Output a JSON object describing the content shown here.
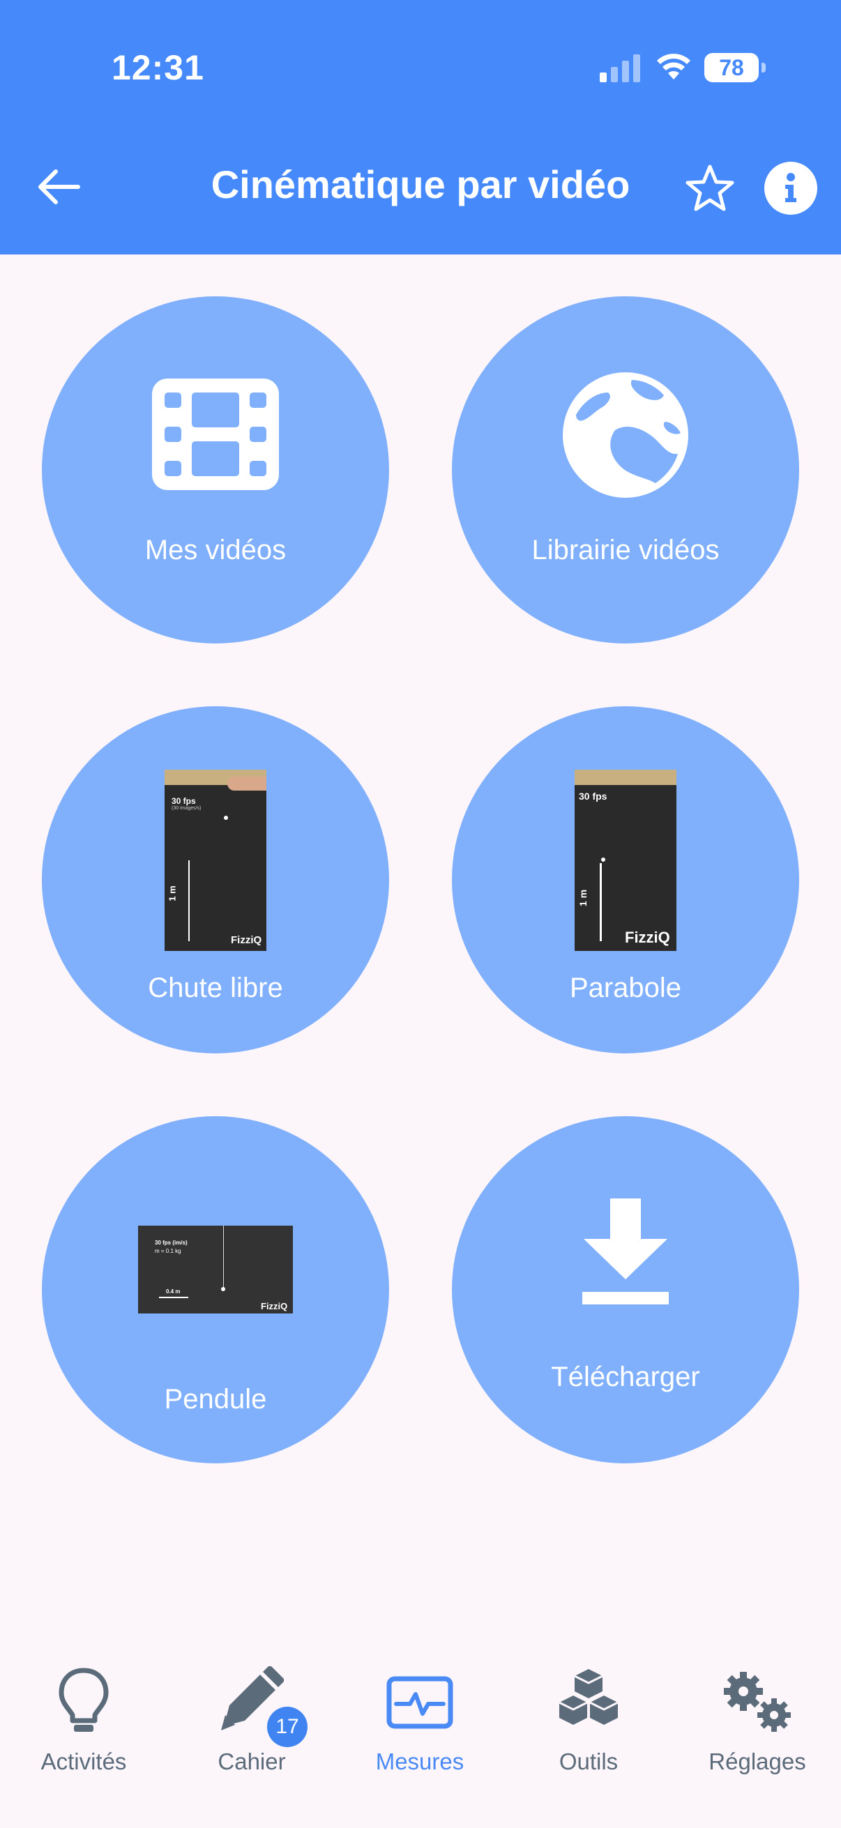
{
  "status": {
    "time": "12:31",
    "battery": "78"
  },
  "header": {
    "title": "Cinématique par vidéo"
  },
  "tiles": [
    {
      "label": "Mes vidéos",
      "icon": "film-icon"
    },
    {
      "label": "Librairie vidéos",
      "icon": "globe-icon"
    },
    {
      "label": "Chute libre",
      "icon": "free-fall-thumbnail",
      "thumb_fps": "30 fps",
      "thumb_fps_sub": "(30 images/s)",
      "thumb_scale": "1 m",
      "thumb_brand": "FizziQ"
    },
    {
      "label": "Parabole",
      "icon": "parabola-thumbnail",
      "thumb_fps": "30 fps",
      "thumb_scale": "1 m",
      "thumb_brand": "FizziQ"
    },
    {
      "label": "Pendule",
      "icon": "pendulum-thumbnail",
      "thumb_fps": "30 fps (im/s)",
      "thumb_mass": "m = 0.1 kg",
      "thumb_scale": "0.4 m",
      "thumb_brand": "FizziQ"
    },
    {
      "label": "Télécharger",
      "icon": "download-icon"
    }
  ],
  "tabs": [
    {
      "label": "Activités",
      "icon": "lightbulb-icon"
    },
    {
      "label": "Cahier",
      "icon": "notebook-pen-icon",
      "badge": "17"
    },
    {
      "label": "Mesures",
      "icon": "measurements-icon",
      "active": true
    },
    {
      "label": "Outils",
      "icon": "cubes-icon"
    },
    {
      "label": "Réglages",
      "icon": "gears-icon"
    }
  ],
  "colors": {
    "header": "#4589fa",
    "tile": "#80b0fb",
    "active_tab": "#4a8af4",
    "inactive_tab": "#5b6b7a",
    "background": "#fcf6fb"
  }
}
